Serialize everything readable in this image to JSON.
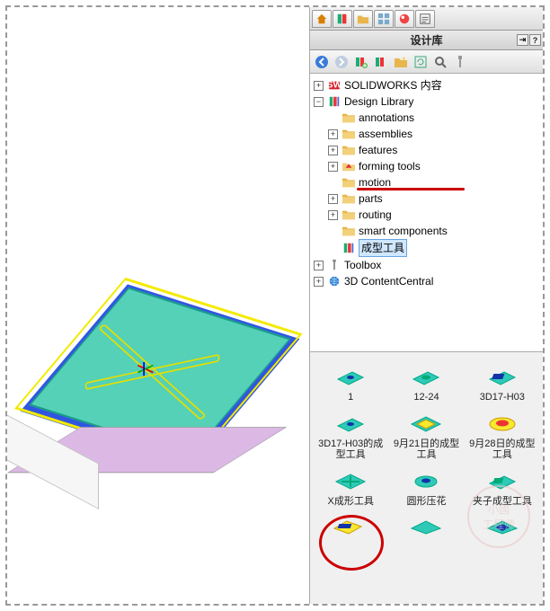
{
  "title": "设计库",
  "tree": {
    "root": [
      {
        "label": "SOLIDWORKS 内容"
      },
      {
        "label": "Design Library",
        "children": [
          "annotations",
          "assemblies",
          "features",
          "forming tools",
          "motion",
          "parts",
          "routing",
          "smart components"
        ],
        "extra": "成型工具"
      },
      {
        "label": "Toolbox"
      },
      {
        "label": "3D ContentCentral"
      }
    ]
  },
  "items": [
    {
      "label": "1"
    },
    {
      "label": "12-24"
    },
    {
      "label": "3D17-H03"
    },
    {
      "label": "3D17-H03的成型工具"
    },
    {
      "label": "9月21日的成型工具"
    },
    {
      "label": "9月28日的成型工具"
    },
    {
      "label": "X成形工具"
    },
    {
      "label": "圆形压花"
    },
    {
      "label": "夹子成型工具"
    }
  ],
  "watermark_top": "小國",
  "watermark_bottom": "工程师"
}
